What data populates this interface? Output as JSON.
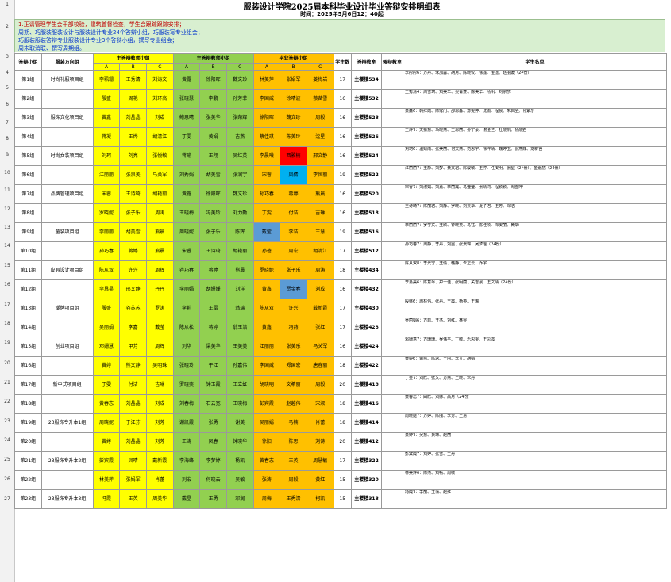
{
  "title": "服装设计学院2025届本科毕业设计毕业答辩安排明细表",
  "time": "时间：2025年5月6日12：40起",
  "notes": [
    "1.正请管理学生会干部校验，建筑首督检查，学生会跟踪跟踪安排；",
    "周期、巧服装服装设计与服装设计专业24个答辩小组，巧服装写专业组会；",
    "巧服装服装答辩专业服装设计专业3个答辩小组，撰写专业组会；",
    "周末取消联、撰写周期组。"
  ],
  "row_numbers": [
    "1",
    "2",
    "3",
    "4",
    "5",
    "6",
    "7",
    "8",
    "9",
    "10",
    "11",
    "12",
    "13",
    "14",
    "15",
    "16",
    "17",
    "18",
    "19",
    "20",
    "21",
    "22",
    "23",
    "24",
    "25",
    "26",
    "27"
  ],
  "headers": {
    "group": "答辩小组",
    "direction": "服装方向组",
    "teacherA": "主答辩教师小组",
    "teacherB": "主答辩教师小组",
    "teacherC": "毕业答辩小组",
    "count": "学生数",
    "room": "答辩教室",
    "room2": "候辩教室",
    "students": "学生名单",
    "A": "A",
    "B": "B",
    "C": "C"
  },
  "rows": [
    {
      "g": "第1组",
      "d": "时尚礼服项目组",
      "a": [
        "李珮珊",
        "王秀清",
        "刘涛文"
      ],
      "b": [
        "黄露",
        "徐阳晖",
        "魏文珍"
      ],
      "c": [
        "林美萍",
        "张娟军",
        "姜梅岩"
      ],
      "n": "17",
      "r": "主楼楼534",
      "s": "李彤彤6：方丹、朱加淼、胡月、陈晓仪、徐鑫、金嘉、赵丽媛（24份）"
    },
    {
      "g": "第2组",
      "d": "",
      "a": [
        "殷盛",
        "周艳",
        "刘环高"
      ],
      "b": [
        "张晓慧",
        "李鹏",
        "孙芳菲"
      ],
      "c": [
        "李国威",
        "徐晴波",
        "蔡苗雪"
      ],
      "n": "16",
      "r": "主楼楼532",
      "s": "王秀清4：周雪珂、刘美华、吴菁菱、陈美华、杨帆、刘宗彦"
    },
    {
      "g": "第3组",
      "d": "服饰文化项目组",
      "a": [
        "黄鑫",
        "刘晶晶",
        "刘成"
      ],
      "b": [
        "鲍思晴",
        "张美华",
        "张荣辉"
      ],
      "c": [
        "徐阳晖",
        "魏文珍",
        "周毅"
      ],
      "n": "16",
      "r": "主楼楼528",
      "s": "黄鑫6：韩红霞、陈家门、邵思淼、苏雯婷、沈雨、程晨、朱启圣、孙紫乐"
    },
    {
      "g": "第4组",
      "d": "",
      "a": [
        "蒋凝",
        "王烨",
        "胡清江"
      ],
      "b": [
        "丁雯",
        "黄娟",
        "吉燕"
      ],
      "c": [
        "蔡佳琪",
        "陈美玲",
        "沈星"
      ],
      "n": "16",
      "r": "主楼楼526",
      "s": "王烨7：文振慧、马晓燕、王思丽、孙宁豪、谢金兰、杜晓凯、杨晓君"
    },
    {
      "g": "第5组",
      "d": "时尚女装项目组",
      "a": [
        "刘珂",
        "刘亮",
        "张悦敏"
      ],
      "b": [
        "蒋瑜",
        "王翔",
        "吴红英"
      ],
      "c": [
        "李晨曦",
        "西雅楠",
        "邢文静"
      ],
      "n": "16",
      "r": "主楼楼524",
      "s": "刘珂6：温妍雨、张美丽、何文燕、范思宇、徐梓晴、魏婷玉、张燕菲、龙新言"
    },
    {
      "g": "第6组",
      "d": "",
      "a": [
        "江丽丽",
        "张泉美",
        "马关军"
      ],
      "b": [
        "刘秀娟",
        "胡美雪",
        "张润宇"
      ],
      "c": [
        "宋睿",
        "凤倩",
        "李恒丽"
      ],
      "n": "19",
      "r": "主楼楼522",
      "s": "江丽丽7：王静、刘梦、黄文君、陈骏敏、王婷、任安明、张星（24份）、金嘉慧（24份）"
    },
    {
      "g": "第7组",
      "d": "品牌管理项目组",
      "a": [
        "宋睿",
        "王诗琦",
        "胡艳丽"
      ],
      "b": [
        "黄鑫",
        "徐阳晖",
        "魏文珍"
      ],
      "c": [
        "孙巧春",
        "蒋婷",
        "熊晨"
      ],
      "n": "16",
      "r": "主楼楼520",
      "s": "宋睿7：刘淑娟、刘嘉、李丽霞、马莹莹、张晴莉、程颖颖、周雪萍"
    },
    {
      "g": "第8组",
      "d": "",
      "a": [
        "罗晓妮",
        "张子乐",
        "周涛"
      ],
      "b": [
        "王晓梅",
        "冯美玲",
        "刘力勤"
      ],
      "c": [
        "丁雯",
        "付洁",
        "吉琳"
      ],
      "n": "16",
      "r": "主楼楼518",
      "s": "王诗琦7：陈丽君、刘静、罗晓、刘美华、夏子君、王芳、邓洁"
    },
    {
      "g": "第9组",
      "d": "童装项目组",
      "a": [
        "李丽丽",
        "胡美雪",
        "熊晨"
      ],
      "b": [
        "周晓妮",
        "张子乐",
        "陈辉"
      ],
      "c": [
        "戴莹",
        "李洁",
        "王慧"
      ],
      "n": "19",
      "r": "主楼楼516",
      "s": "李丽丽7：罗学文、王欣、钟晓英、马钰、陈佳颖、郭安丽、黄华"
    },
    {
      "g": "第10组",
      "d": "",
      "a": [
        "孙巧春",
        "蒋婷",
        "熊晨"
      ],
      "b": [
        "宋睿",
        "王诗琦",
        "胡艳丽"
      ],
      "c": [
        "孙蓓",
        "周宏",
        "胡清江"
      ],
      "n": "17",
      "r": "主楼楼512",
      "s": "孙巧春7：周静、李丹、刘雯、张景琳、吴梦瑶（24份）"
    },
    {
      "g": "第11组",
      "d": "皮具设计项目组",
      "a": [
        "陈从双",
        "许兴",
        "周辉"
      ],
      "b": [
        "谷巧春",
        "蒋婷",
        "熊晨"
      ],
      "c": [
        "罗晓妮",
        "张子乐",
        "周涛"
      ],
      "n": "18",
      "r": "主楼楼434",
      "s": "陈从双8：李光宁、王倩、韩静、朱正云、乔宇"
    },
    {
      "g": "第12组",
      "d": "",
      "a": [
        "李恳昊",
        "邢文静",
        "丹丹"
      ],
      "b": [
        "李丽娟",
        "胡姗姗",
        "刘洋"
      ],
      "c": [
        "黄鑫",
        "贾金春",
        "刘成"
      ],
      "n": "16",
      "r": "主楼楼432",
      "s": "李恳昊6：陈意琴、郑十佳、张明丽、关雪晨、王文晴（24份）"
    },
    {
      "g": "第13组",
      "d": "潮牌项目组",
      "a": [
        "殷盛",
        "谷苏苏",
        "罗涛"
      ],
      "b": [
        "李莉",
        "王雷",
        "翁瑞"
      ],
      "c": [
        "陈从双",
        "许兴",
        "戴新霞"
      ],
      "n": "17",
      "r": "主楼楼430",
      "s": "殷盛6：周林伟、张丹、王霞、杨英、王琳"
    },
    {
      "g": "第14组",
      "d": "",
      "a": [
        "吴丽娟",
        "李嘉",
        "戴莹"
      ],
      "b": [
        "陈从松",
        "蒋婷",
        "翁玉洁"
      ],
      "c": [
        "黄鑫",
        "冯燕",
        "张红"
      ],
      "n": "17",
      "r": "主楼楼428",
      "s": "吴丽娟6：方菲、王杰、刘红、林雯"
    },
    {
      "g": "第15组",
      "d": "创业项目组",
      "a": [
        "邓姗慧",
        "甲芳",
        "周辉"
      ],
      "b": [
        "刘华",
        "梁美华",
        "王美美"
      ],
      "c": [
        "江丽丽",
        "张美乐",
        "马关军"
      ],
      "n": "16",
      "r": "主楼楼424",
      "s": "邓姗慧7：方珊珊、吴伟平、丁敏、乐思雯、王彩霞"
    },
    {
      "g": "第16组",
      "d": "",
      "a": [
        "黄婷",
        "熊文静",
        "吴明珠"
      ],
      "b": [
        "张晓玲",
        "于江",
        "孙嘉伟"
      ],
      "c": [
        "李国威",
        "郑国宏",
        "唐春丽"
      ],
      "n": "18",
      "r": "主楼楼422",
      "s": "黄婷6：谢燕、陈思、王丽、李立、胡娟"
    },
    {
      "g": "第17组",
      "d": "新中式项目组",
      "a": [
        "丁雯",
        "付洁",
        "吉琳"
      ],
      "b": [
        "罗晓奕",
        "钟玉霞",
        "王立虹"
      ],
      "c": [
        "胡晓明",
        "文希丽",
        "周毅"
      ],
      "n": "20",
      "r": "主楼楼418",
      "s": "丁雯7：刘欣、张文、方燕、王晓、朱丹"
    },
    {
      "g": "第18组",
      "d": "",
      "a": [
        "黄春志",
        "刘晶晶",
        "刘成"
      ],
      "b": [
        "刘春梅",
        "石云宽",
        "王晓梅"
      ],
      "c": [
        "彭宾霞",
        "赵越伟",
        "宋淑"
      ],
      "n": "18",
      "r": "主楼楼416",
      "s": "黄春志7：曲欣、刘娜、高月（24份）"
    },
    {
      "g": "第19组",
      "d": "23服饰专升本1组",
      "a": [
        "周晓妮",
        "于江芬",
        "刘芳"
      ],
      "b": [
        "谢凯霞",
        "张勇",
        "谢美"
      ],
      "c": [
        "吴丽娟",
        "马楠",
        "肖蕾"
      ],
      "n": "18",
      "r": "主楼楼414",
      "s": "周晓妮7：方婷、陈丽、李芳、王慧"
    },
    {
      "g": "第20组",
      "d": "",
      "a": [
        "黄婷",
        "刘晶晶",
        "刘芳"
      ],
      "b": [
        "王涛",
        "凤春",
        "钟晓华"
      ],
      "c": [
        "徐阳",
        "陈思",
        "刘诗"
      ],
      "n": "20",
      "r": "主楼楼412",
      "s": "黄婷7：吴慧、黄琳、赵丽"
    },
    {
      "g": "第21组",
      "d": "23服饰专升本2组",
      "a": [
        "彭宾霞",
        "凤晴",
        "戴新霞"
      ],
      "b": [
        "李海峰",
        "李梦婷",
        "杨凯"
      ],
      "c": [
        "黄春志",
        "王英",
        "周慧敏"
      ],
      "n": "17",
      "r": "主楼楼322",
      "s": "彭宾霞7：刘婷、张雪、王丹"
    },
    {
      "g": "第22组",
      "d": "",
      "a": [
        "林美萍",
        "张娟军",
        "肖蕾"
      ],
      "b": [
        "刘宏",
        "何晓云",
        "吴敏"
      ],
      "c": [
        "张涛",
        "周毅",
        "黄红"
      ],
      "n": "15",
      "r": "主楼楼320",
      "s": "林美萍6：陈杰、刘畅、周敏"
    },
    {
      "g": "第23组",
      "d": "23服饰专升本3组",
      "a": [
        "冯霞",
        "王英",
        "周美华"
      ],
      "b": [
        "戴晶",
        "王勇",
        "邓润"
      ],
      "c": [
        "周梅",
        "王秀清",
        "柯凯"
      ],
      "n": "15",
      "r": "主楼楼318",
      "s": "冯霞7：李丽、王倩、赵红"
    }
  ]
}
